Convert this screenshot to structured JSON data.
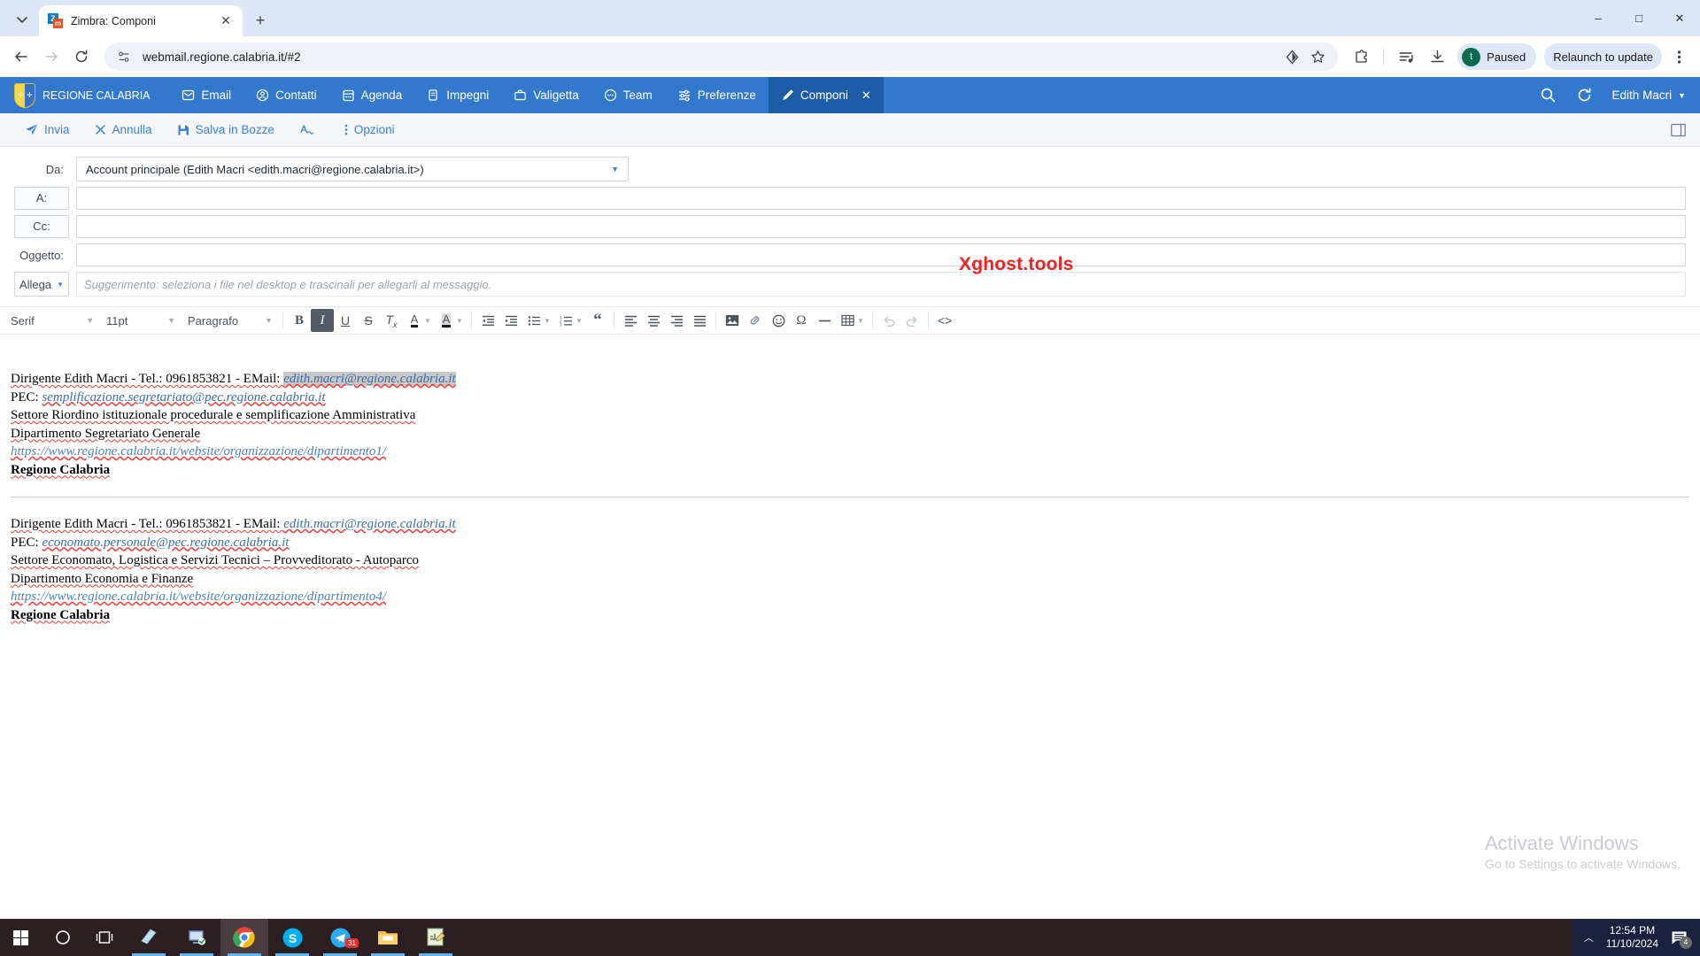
{
  "browser": {
    "tab": {
      "title": "Zimbra: Componi",
      "favicon_letters": [
        "Z",
        "m"
      ],
      "close_icon": "close-icon"
    },
    "new_tab_label": "+",
    "tab_search_icon": "chevron-down-icon",
    "window_controls": {
      "minimize": "–",
      "maximize": "□",
      "close": "✕"
    },
    "nav": {
      "back_icon": "back-arrow-icon",
      "forward_icon": "forward-arrow-icon",
      "reload_icon": "reload-icon"
    },
    "omnibox": {
      "site_info_icon": "site-settings-icon",
      "url": "webmail.regione.calabria.it/#2",
      "split_view_icon": "split-view-icon",
      "bookmark_icon": "star-icon"
    },
    "toolbar_right": {
      "extensions_icon": "extensions-puzzle-icon",
      "reading_list_icon": "reading-list-icon",
      "downloads_icon": "download-icon",
      "profile_label": "Paused",
      "profile_avatar_letter": "t",
      "relaunch_label": "Relaunch to update",
      "menu_icon": "three-dot-menu-icon"
    }
  },
  "zimbra": {
    "brand": "REGIONE CALABRIA",
    "nav_items": [
      {
        "label": "Email",
        "icon": "email-icon",
        "active": false
      },
      {
        "label": "Contatti",
        "icon": "contacts-icon",
        "active": false
      },
      {
        "label": "Agenda",
        "icon": "calendar-icon",
        "active": false
      },
      {
        "label": "Impegni",
        "icon": "tasks-icon",
        "active": false
      },
      {
        "label": "Valigetta",
        "icon": "briefcase-icon",
        "active": false
      },
      {
        "label": "Team",
        "icon": "team-icon",
        "active": false
      },
      {
        "label": "Preferenze",
        "icon": "preferences-icon",
        "active": false
      },
      {
        "label": "Componi",
        "icon": "compose-pencil-icon",
        "active": true
      }
    ],
    "search_icon": "search-icon",
    "refresh_icon": "refresh-icon",
    "user_name": "Edith Macri",
    "user_caret_icon": "chevron-down-icon"
  },
  "compose_toolbar": {
    "send": {
      "label": "Invia",
      "icon": "send-paperplane-icon"
    },
    "cancel": {
      "label": "Annulla",
      "icon": "close-x-icon"
    },
    "save_draft": {
      "label": "Salva in Bozze",
      "icon": "floppy-disk-icon"
    },
    "spellcheck": {
      "label": "",
      "icon": "spellcheck-icon"
    },
    "options": {
      "label": "Opzioni",
      "icon": "three-dot-vertical-icon"
    },
    "layout_icon": "reading-pane-icon"
  },
  "fields": {
    "from_label": "Da:",
    "from_value": "Account principale (Edith Macri <edith.macri@regione.calabria.it>)",
    "from_caret_icon": "chevron-down-icon",
    "to_label": "A:",
    "to_value": "",
    "cc_label": "Cc:",
    "cc_value": "",
    "subject_label": "Oggetto:",
    "subject_value": "",
    "attach_label": "Allega",
    "attach_caret_icon": "chevron-down-icon",
    "attach_hint": "Suggerimento: seleziona i file nel desktop e trascinali per allegarli al messaggio."
  },
  "editor_toolbar": {
    "font_family": "Serif",
    "font_size": "11pt",
    "paragraph_style": "Paragrafo",
    "buttons": [
      {
        "name": "bold-button",
        "glyph": "B",
        "active": false
      },
      {
        "name": "italic-button",
        "glyph": "I",
        "active": true
      },
      {
        "name": "underline-button",
        "glyph": "U",
        "active": false
      },
      {
        "name": "strikethrough-button",
        "glyph": "S",
        "active": false
      },
      {
        "name": "remove-format-button",
        "glyph": "Tx",
        "active": false
      },
      {
        "name": "text-color-button",
        "glyph": "A",
        "active": false
      },
      {
        "name": "highlight-color-button",
        "glyph": "A",
        "active": false
      },
      {
        "name": "outdent-button",
        "glyph": "outdent",
        "active": false
      },
      {
        "name": "indent-button",
        "glyph": "indent",
        "active": false
      },
      {
        "name": "bullet-list-button",
        "glyph": "bullets",
        "active": false
      },
      {
        "name": "numbered-list-button",
        "glyph": "numbers",
        "active": false
      },
      {
        "name": "blockquote-button",
        "glyph": "“",
        "active": false
      },
      {
        "name": "align-left-button",
        "glyph": "align-left",
        "active": false
      },
      {
        "name": "align-center-button",
        "glyph": "align-center",
        "active": false
      },
      {
        "name": "align-right-button",
        "glyph": "align-right",
        "active": false
      },
      {
        "name": "align-justify-button",
        "glyph": "align-justify",
        "active": false
      },
      {
        "name": "insert-image-button",
        "glyph": "image",
        "active": false
      },
      {
        "name": "insert-link-button",
        "glyph": "link",
        "active": false
      },
      {
        "name": "emoji-button",
        "glyph": "☺",
        "active": false
      },
      {
        "name": "special-character-button",
        "glyph": "Ω",
        "active": false
      },
      {
        "name": "horizontal-rule-button",
        "glyph": "—",
        "active": false
      },
      {
        "name": "insert-table-button",
        "glyph": "table",
        "active": false
      },
      {
        "name": "undo-button",
        "glyph": "undo",
        "active": false
      },
      {
        "name": "redo-button",
        "glyph": "redo",
        "active": false
      },
      {
        "name": "source-code-button",
        "glyph": "<>",
        "active": false
      }
    ]
  },
  "signatures": [
    {
      "line1_prefix": "Dirigente Edith Macri - Tel.: 0961853821 - EMail: ",
      "email": "edith.macri@regione.calabria.it",
      "email_selected": true,
      "pec_label": "PEC: ",
      "pec": "semplificazione.segretariato@pec.regione.calabria.it",
      "settore": "Settore Riordino istituzionale procedurale e semplificazione Amministrativa",
      "dipartimento": "Dipartimento Segretariato Generale",
      "url": "https://www.regione.calabria.it/website/organizzazione/dipartimento1/",
      "org": "Regione Calabria"
    },
    {
      "line1_prefix": "Dirigente Edith Macri - Tel.: 0961853821 - EMail: ",
      "email": "edith.macri@regione.calabria.it",
      "email_selected": false,
      "pec_label": "PEC: ",
      "pec": "economato.personale@pec.regione.calabria.it",
      "settore": "Settore Economato, Logistica e Servizi Tecnici – Provveditorato - Autoparco",
      "dipartimento": "Dipartimento Economia e Finanze",
      "url": "https://www.regione.calabria.it/website/organizzazione/dipartimento4/",
      "org": "Regione Calabria"
    }
  ],
  "watermark": {
    "text": "Xghost.tools",
    "color": "#ee2222"
  },
  "activate_windows": {
    "title": "Activate Windows",
    "subtitle": "Go to Settings to activate Windows."
  },
  "taskbar": {
    "start_icon": "windows-start-icon",
    "search_icon": "search-circle-icon",
    "task_view_icon": "task-view-icon",
    "apps": [
      {
        "name": "sticky-notes-icon",
        "running": true,
        "active": false
      },
      {
        "name": "remote-desktop-icon",
        "running": true,
        "active": false
      },
      {
        "name": "google-chrome-icon",
        "running": true,
        "active": true
      },
      {
        "name": "skype-icon",
        "running": true,
        "active": false
      },
      {
        "name": "telegram-icon",
        "running": true,
        "active": false,
        "badge": "31"
      },
      {
        "name": "file-explorer-icon",
        "running": true,
        "active": false
      },
      {
        "name": "notepad-editor-icon",
        "running": true,
        "active": false
      }
    ],
    "tray": {
      "chevron_icon": "show-hidden-icons-chevron",
      "time": "12:54 PM",
      "date": "11/10/2024",
      "notification_icon": "notification-icon",
      "notification_count": "4"
    }
  }
}
